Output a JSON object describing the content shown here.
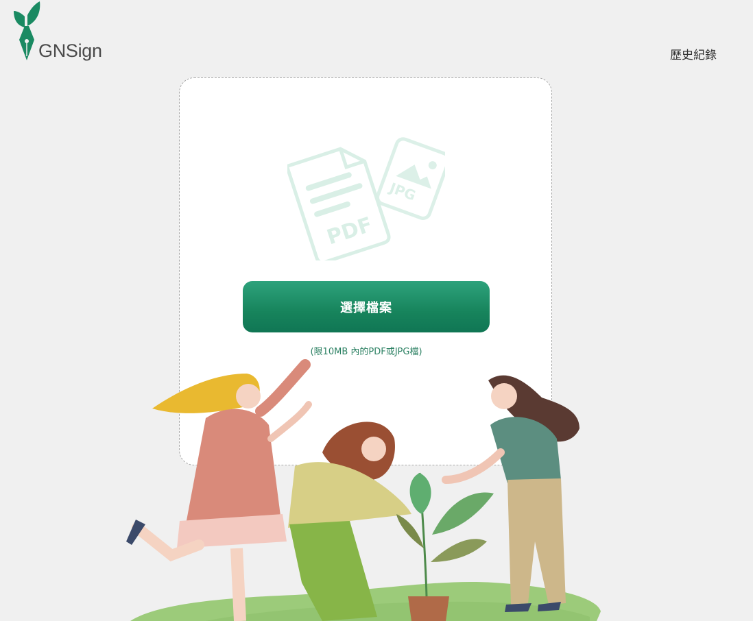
{
  "header": {
    "logo_text": "GNSign",
    "logo_icon": "pen-nib-leaf-icon",
    "history_label": "歷史紀錄"
  },
  "upload": {
    "icons": "pdf-jpg-file-icons",
    "pdf_label": "PDF",
    "jpg_label": "JPG",
    "button_label": "選擇檔案",
    "hint": "(限10MB 內的PDF或JPG檔)"
  },
  "colors": {
    "brand_green": "#1a8a62",
    "background": "#f0f0f0",
    "hint_green": "#2b8062"
  }
}
